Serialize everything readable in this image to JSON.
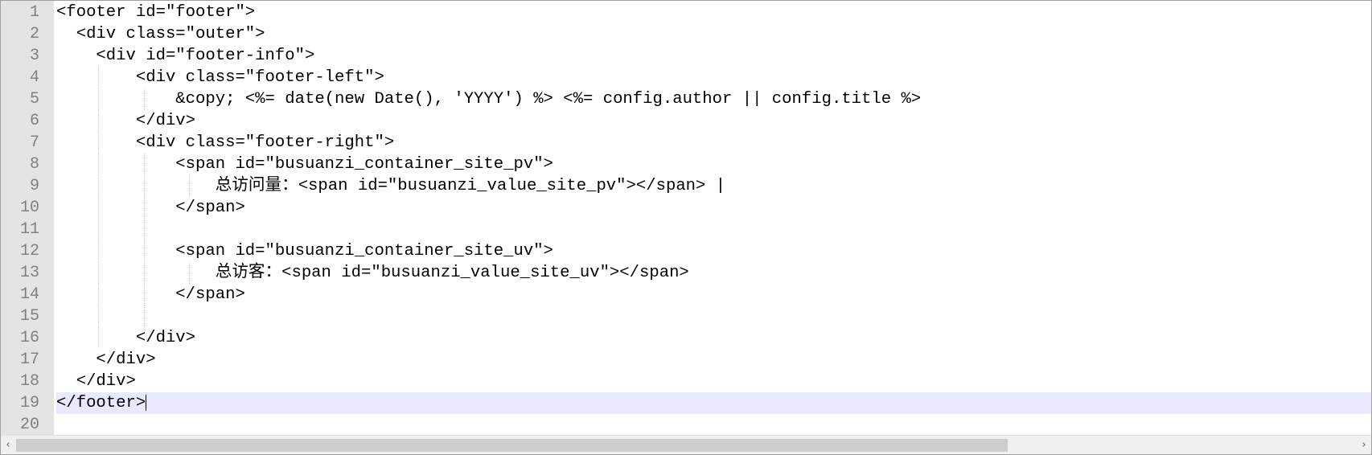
{
  "editor": {
    "current_line": 19,
    "lines": [
      {
        "num": "1",
        "text": "<footer id=\"footer\">"
      },
      {
        "num": "2",
        "text": "  <div class=\"outer\">"
      },
      {
        "num": "3",
        "text": "    <div id=\"footer-info\">"
      },
      {
        "num": "4",
        "text": "        <div class=\"footer-left\">"
      },
      {
        "num": "5",
        "text": "            &copy; <%= date(new Date(), 'YYYY') %> <%= config.author || config.title %>"
      },
      {
        "num": "6",
        "text": "        </div>"
      },
      {
        "num": "7",
        "text": "        <div class=\"footer-right\">"
      },
      {
        "num": "8",
        "text": "            <span id=\"busuanzi_container_site_pv\">"
      },
      {
        "num": "9",
        "text": "                总访问量：<span id=\"busuanzi_value_site_pv\"></span> |"
      },
      {
        "num": "10",
        "text": "            </span>"
      },
      {
        "num": "11",
        "text": ""
      },
      {
        "num": "12",
        "text": "            <span id=\"busuanzi_container_site_uv\">"
      },
      {
        "num": "13",
        "text": "                总访客：<span id=\"busuanzi_value_site_uv\"></span>"
      },
      {
        "num": "14",
        "text": "            </span>"
      },
      {
        "num": "15",
        "text": ""
      },
      {
        "num": "16",
        "text": "        </div>"
      },
      {
        "num": "17",
        "text": "    </div>"
      },
      {
        "num": "18",
        "text": "  </div>"
      },
      {
        "num": "19",
        "text": "</footer>"
      },
      {
        "num": "20",
        "text": ""
      }
    ]
  },
  "scrollbar": {
    "left_arrow": "‹",
    "right_arrow": "›",
    "position": 0.0,
    "visible_fraction": 0.73
  },
  "colors": {
    "gutter_bg": "#e4e4e4",
    "line_number": "#808080",
    "current_line_bg": "#e8e8ff",
    "text": "#000000"
  }
}
